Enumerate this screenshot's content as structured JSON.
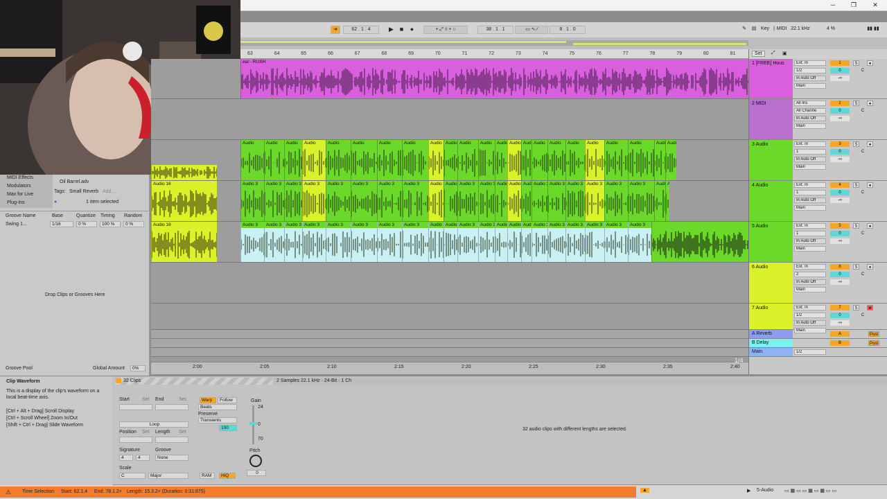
{
  "titlebar": {
    "minimize": "─",
    "restore": "❐",
    "close": "✕"
  },
  "transport": {
    "song_position": "62 .  1 .  4",
    "arrangement_position": "38 .  1 .  1",
    "loop_length": "8 .  1 .  0",
    "key_label": "Key",
    "midi_label": "MIDI",
    "sample_rate": "22.1 kHz",
    "cpu": "4 %"
  },
  "bar_numbers": [
    "63",
    "64",
    "65",
    "66",
    "67",
    "68",
    "69",
    "70",
    "71",
    "72",
    "73",
    "74",
    "75",
    "76",
    "77",
    "78",
    "79",
    "80",
    "81"
  ],
  "set_label": "Set",
  "time_ticks": [
    "2:00",
    "2:05",
    "2:10",
    "2:15",
    "2:20",
    "2:25",
    "2:30",
    "2:35",
    "2:40"
  ],
  "zoom_fraction": "1/4",
  "tracks": [
    {
      "name": "1 [FREE] Hous",
      "clip_label": "eat - RUSH",
      "color": "#da5fdf",
      "input": "Ext. In",
      "channel": "1/2",
      "num": "1",
      "vol": "0",
      "pan": "C",
      "inf": "-∞",
      "out": "Main"
    },
    {
      "name": "2 MIDI",
      "clip_label": "",
      "color": "#b96fcf",
      "input": "All Ins",
      "channel": "All Channe",
      "num": "2",
      "vol": "0",
      "pan": "C",
      "inf": "-∞",
      "out": "Main"
    },
    {
      "name": "3 Audio",
      "clip_label": "Audio",
      "color": "#6bd92a",
      "input": "Ext. In",
      "channel": "1",
      "num": "3",
      "vol": "0",
      "pan": "C",
      "inf": "-∞",
      "out": "Main"
    },
    {
      "name": "4 Audio",
      "clip_label": "Audio 3",
      "color": "#6bd92a",
      "input": "Ext. In",
      "channel": "1",
      "num": "4",
      "vol": "0",
      "pan": "C",
      "inf": "-∞",
      "out": "Main"
    },
    {
      "name": "5 Audio",
      "clip_label": "Audio 3",
      "color": "#6bd92a",
      "input": "Ext. In",
      "channel": "1",
      "num": "5",
      "vol": "0",
      "pan": "C",
      "inf": "-∞",
      "out": "Main"
    },
    {
      "name": "6 Audio",
      "clip_label": "",
      "color": "#d9f22a",
      "input": "Ext. In",
      "channel": "2",
      "num": "6",
      "vol": "0",
      "pan": "C",
      "inf": "-∞",
      "out": "Main"
    },
    {
      "name": "7 Audio",
      "clip_label": "",
      "color": "#d9f22a",
      "input": "Ext. In",
      "channel": "1/2",
      "num": "7",
      "vol": "0",
      "pan": "C",
      "inf": "-∞",
      "out": "Main"
    }
  ],
  "returns": [
    {
      "name": "A Reverb",
      "letter": "A",
      "color": "#8b9cf2",
      "post": "Post"
    },
    {
      "name": "B Delay",
      "letter": "B",
      "color": "#7df0f0",
      "post": "Post"
    },
    {
      "name": "Main",
      "letter": "",
      "color": "#8fb2f5",
      "post": ""
    }
  ],
  "main_channel": "1/2",
  "left_clips_label": "Audio 16",
  "browser": {
    "items": [
      "MIDI Effects",
      "Modulators",
      "Max for Live",
      "Plug-Ins"
    ],
    "file": "Oil Barrel.adv",
    "tags_label": "Tags:",
    "tag": "Small Reverb",
    "add": "Add...",
    "selected": "1 item selected",
    "groove_headers": [
      "Groove Name",
      "Base",
      "Quantize",
      "Timing",
      "Random"
    ],
    "groove_row": [
      "Swing 1...",
      "1/16",
      "0 %",
      "100 %",
      "0 %"
    ],
    "drop_text": "Drop Clips or Grooves Here",
    "groove_pool": "Groove Pool",
    "global_amount_label": "Global Amount",
    "global_amount": "0%"
  },
  "info": {
    "title": "Clip Waveform",
    "body": "This is a display of the clip's waveform on a local beat-time axis.",
    "tips": [
      "[Ctrl + Alt + Drag] Scroll Display",
      "[Ctrl + Scroll Wheel] Zoom In/Out",
      "[Shift + Ctrl + Drag] Slide Waveform"
    ]
  },
  "clip_view": {
    "header": "32 Clips",
    "start": "Start",
    "end": "End",
    "set": "Set",
    "loop": "Loop",
    "position": "Position",
    "length": "Length",
    "signature": "Signature",
    "sig_num": "4",
    "sig_den": "4",
    "groove": "Groove",
    "groove_value": "None",
    "scale": "Scale",
    "scale_root": "C",
    "scale_mode": "Major",
    "warp": "Warp",
    "follow": "Follow",
    "beats": "Beats",
    "preserve": "Preserve",
    "transients": "Transients",
    "tempo_value": "100",
    "ram": "RAM",
    "hiq": "HiQ",
    "gain": "Gain",
    "gain_top": "24",
    "gain_mid": "0",
    "gain_bottom": "70",
    "pitch": "Pitch",
    "pitch_value": "0",
    "sample_info": "2 Samples 22.1 kHz · 24-Bit · 1 Ch",
    "selection_message": "32 audio clips with different lengths are selected."
  },
  "status": {
    "label": "Time Selection",
    "start": "Start: 62.1.4",
    "end": "End: 78.1.2+",
    "length": "Length: 15.3.2+ (Duration: 0:31:875)",
    "track": "5-Audio"
  }
}
